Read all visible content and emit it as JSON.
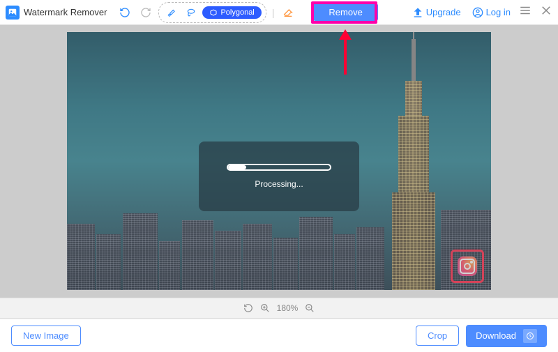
{
  "app": {
    "title": "Watermark Remover"
  },
  "toolbar": {
    "polygonal_label": "Polygonal",
    "remove_label": "Remove",
    "upgrade_label": "Upgrade",
    "login_label": "Log in"
  },
  "processing": {
    "text": "Processing...",
    "progress_percent": 18
  },
  "zoom": {
    "level": "180%"
  },
  "bottom": {
    "new_image_label": "New Image",
    "crop_label": "Crop",
    "download_label": "Download"
  },
  "colors": {
    "accent": "#4d8cff",
    "highlight": "#ff00aa",
    "arrow": "#ff0033"
  },
  "watermark": {
    "icon": "instagram-icon"
  }
}
